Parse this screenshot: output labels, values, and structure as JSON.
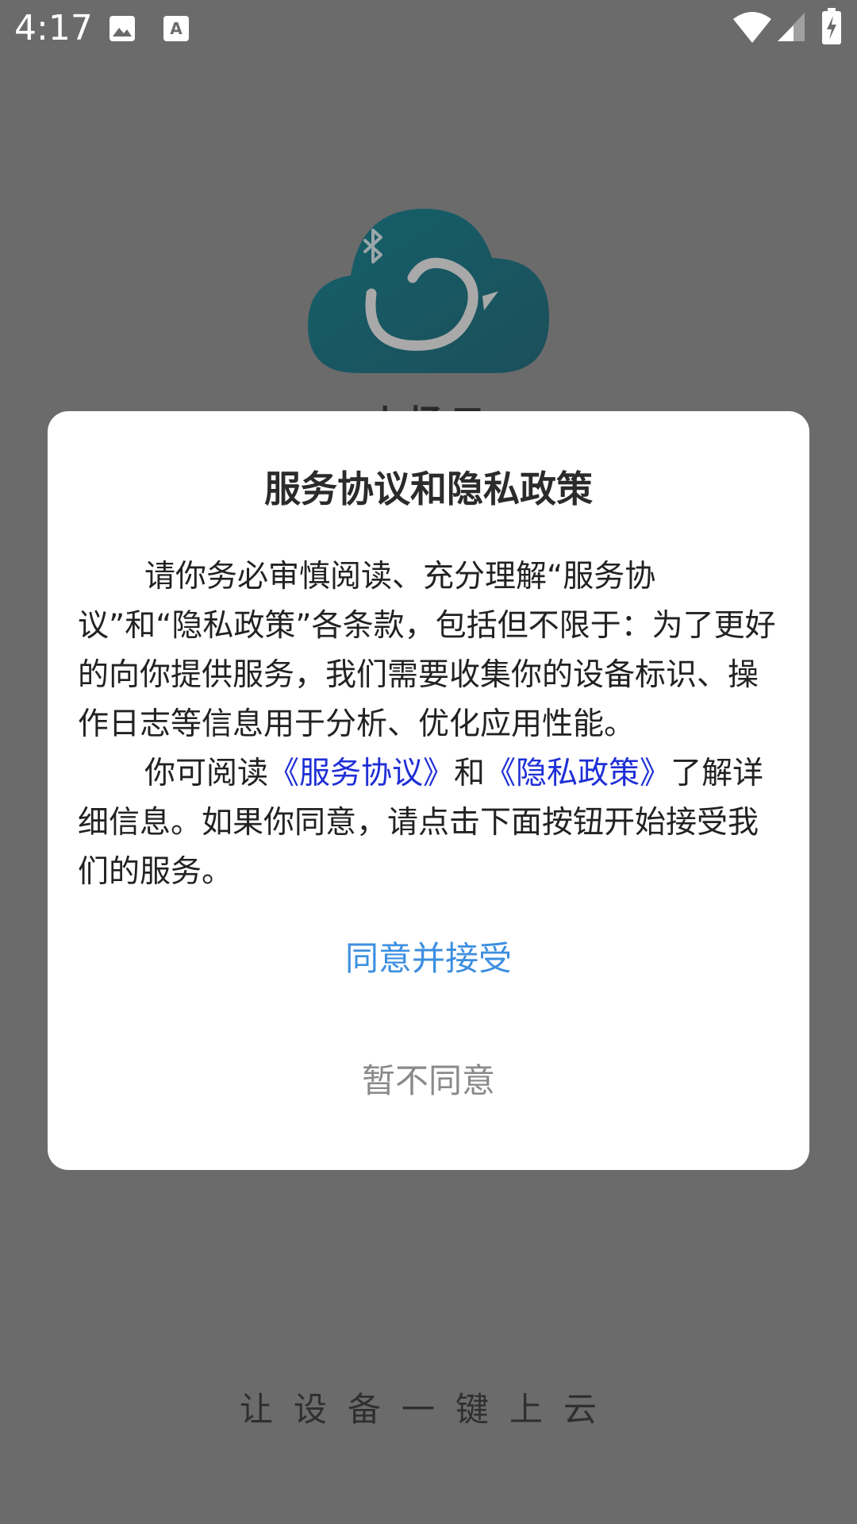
{
  "status_bar": {
    "time": "4:17",
    "icons": [
      "image-icon",
      "font-download-icon",
      "wifi-icon",
      "cellular-signal-icon",
      "battery-charging-icon"
    ]
  },
  "app": {
    "tagline": "让设备一键上云",
    "name_peek": "小扬云"
  },
  "dialog": {
    "title": "服务协议和隐私政策",
    "para1": "请你务必审慎阅读、充分理解“服务协议”和“隐私政策”各条款，包括但不限于：为了更好的向你提供服务，我们需要收集你的设备标识、操作日志等信息用于分析、优化应用性能。",
    "para2_prefix": "你可阅读",
    "service_link": "《服务协议》",
    "para2_and": "和",
    "privacy_link": "《隐私政策》",
    "para2_suffix": "了解详细信息。如果你同意，请点击下面按钮开始接受我们的服务。",
    "agree_label": "同意并接受",
    "decline_label": "暂不同意"
  },
  "colors": {
    "overlay": "#6b6b6b",
    "logo_cloud": "#1f5f68",
    "link": "#1f2fd6",
    "agree": "#3d8fe0",
    "decline": "#8a8a8a"
  }
}
